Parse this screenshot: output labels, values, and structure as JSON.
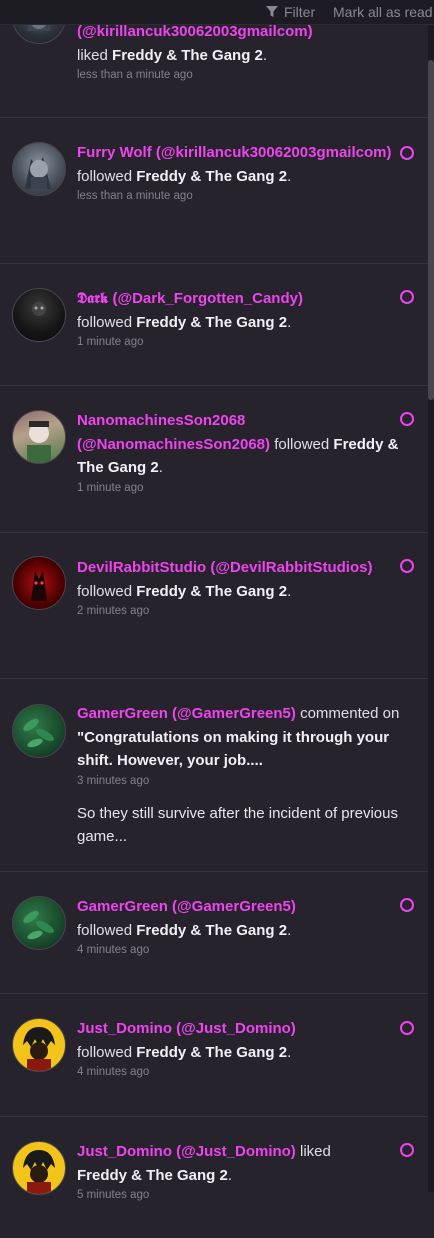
{
  "toolbar": {
    "filter_label": "Filter",
    "mark_all_label": "Mark all as read",
    "filter_icon": "filter-icon"
  },
  "notifications": [
    {
      "user_line": "(@kirillancuk30062003gmailcom)",
      "action": "liked",
      "target": "Freddy & The Gang 2",
      "time": "less than a minute ago",
      "avatar": "wolf-avatar"
    },
    {
      "user": "Furry Wolf (@kirillancuk30062003gmailcom)",
      "action": "followed",
      "target": "Freddy & The Gang 2",
      "time": "less than a minute ago",
      "avatar": "wolf-avatar"
    },
    {
      "user": "𝕯𝖆𝖗𝖐 (@Dark_Forgotten_Candy)",
      "action": "followed",
      "target": "Freddy & The Gang 2",
      "time": "1 minute ago",
      "avatar": "dark-avatar"
    },
    {
      "user": "NanomachinesSon2068 (@NanomachinesSon2068)",
      "action": "followed",
      "target": "Freddy & The Gang 2",
      "time": "1 minute ago",
      "avatar": "nanomachines-avatar"
    },
    {
      "user": "DevilRabbitStudio (@DevilRabbitStudios)",
      "action": "followed",
      "target": "Freddy & The Gang 2",
      "time": "2 minutes ago",
      "avatar": "devil-rabbit-avatar"
    },
    {
      "user": "GamerGreen (@GamerGreen5)",
      "action": "commented on",
      "target": "\"Congratulations on making it through your shift. However, your job....",
      "time": "3 minutes ago",
      "extra": "So they still survive after the incident of previous game...",
      "avatar": "leaf-avatar"
    },
    {
      "user": "GamerGreen (@GamerGreen5)",
      "action": "followed",
      "target": "Freddy & The Gang 2",
      "time": "4 minutes ago",
      "avatar": "leaf-avatar"
    },
    {
      "user": "Just_Domino (@Just_Domino)",
      "action": "followed",
      "target": "Freddy & The Gang 2",
      "time": "4 minutes ago",
      "avatar": "domino-avatar"
    },
    {
      "user": "Just_Domino (@Just_Domino)",
      "action": "liked",
      "target": "Freddy & The Gang 2",
      "time": "5 minutes ago",
      "avatar": "domino-avatar"
    }
  ],
  "colors": {
    "accent": "#ee44ee",
    "background": "#26232c"
  }
}
